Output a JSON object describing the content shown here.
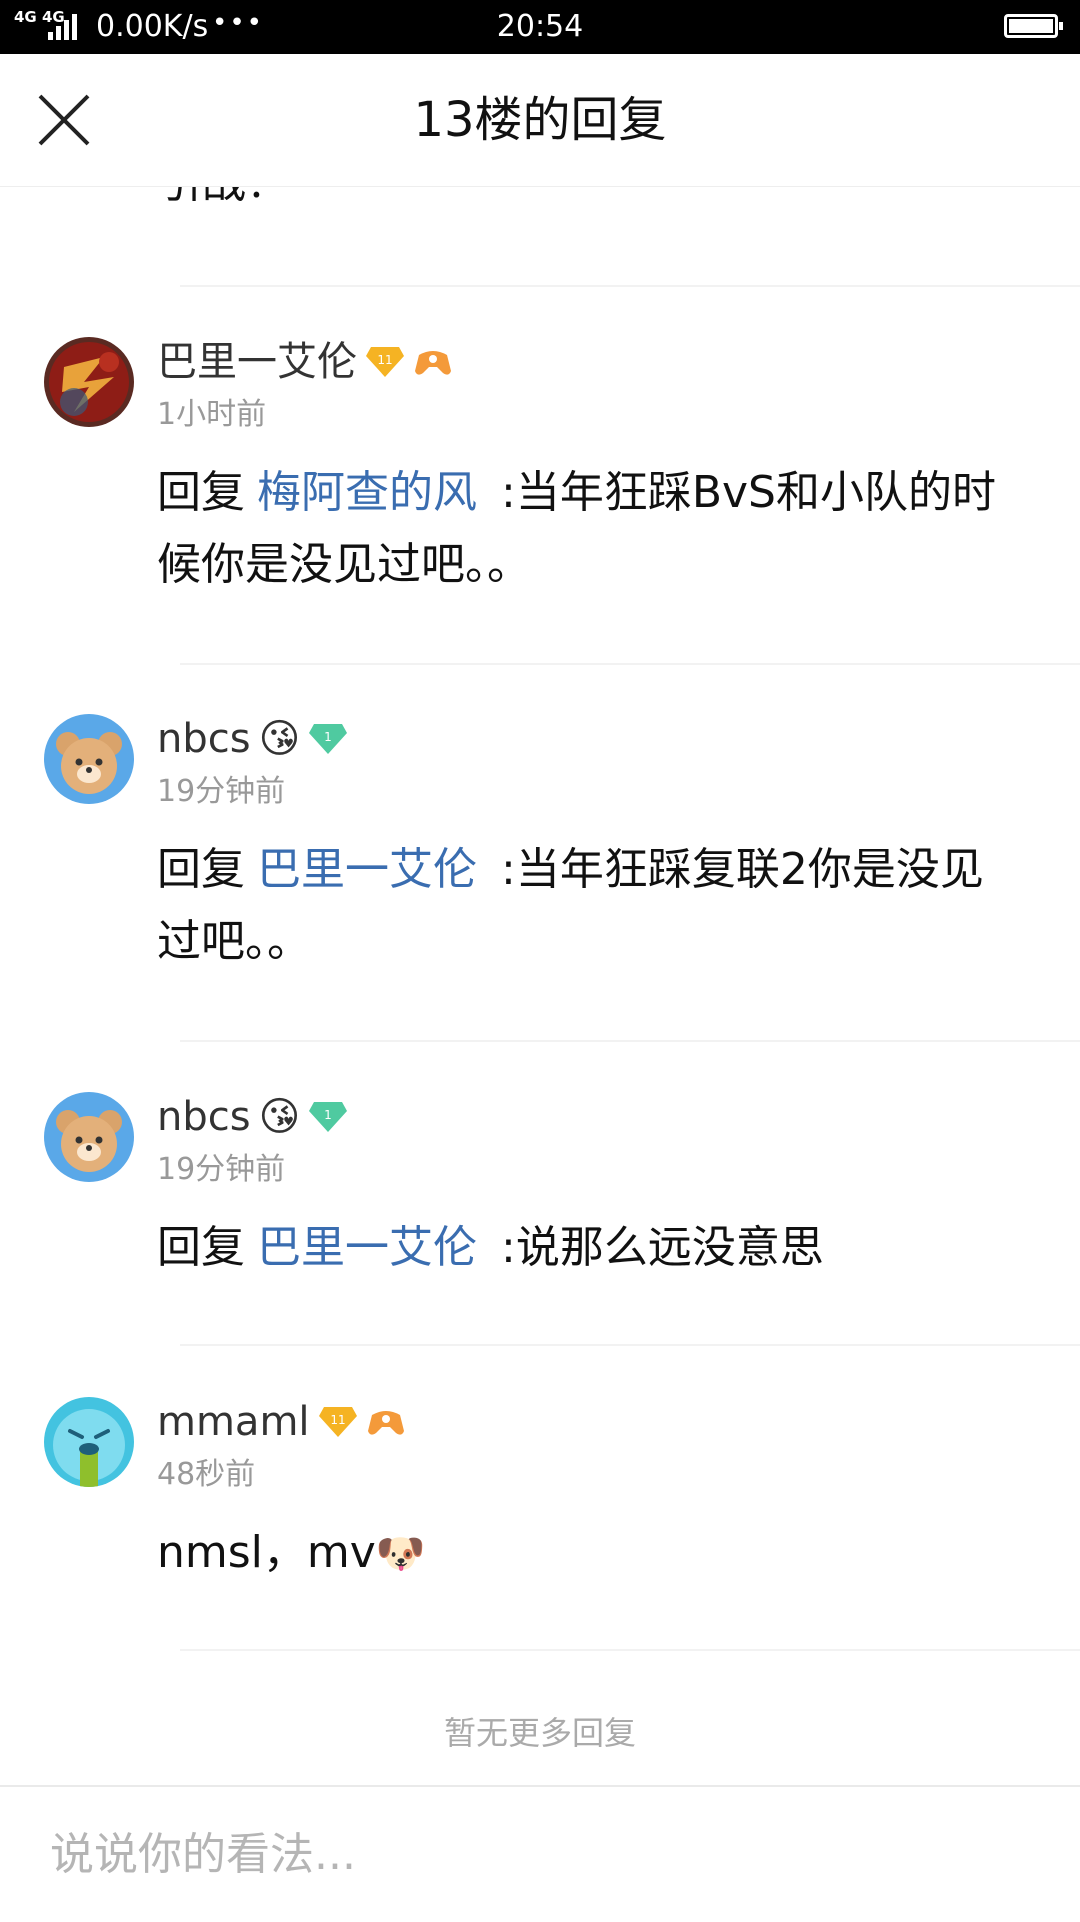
{
  "status_bar": {
    "network": "4G 4G",
    "speed": "0.00K/s",
    "dots": "•••",
    "time": "20:54"
  },
  "header": {
    "title": "13楼的回复"
  },
  "partial_text": "引战？",
  "comments": [
    {
      "username": "巴里一艾伦",
      "level": "11",
      "time": "1小时前",
      "reply_prefix": "回复",
      "reply_target": "梅阿查的风",
      "text": ":当年狂踩BvS和小队的时候你是没见过吧。。"
    },
    {
      "username": "nbcs",
      "emoji": "😘",
      "level": "1",
      "time": "19分钟前",
      "reply_prefix": "回复",
      "reply_target": "巴里一艾伦",
      "text": ":当年狂踩复联2你是没见过吧。。"
    },
    {
      "username": "nbcs",
      "emoji": "😘",
      "level": "1",
      "time": "19分钟前",
      "reply_prefix": "回复",
      "reply_target": "巴里一艾伦",
      "text": ":说那么远没意思"
    },
    {
      "username": "mmaml",
      "level": "11",
      "time": "48秒前",
      "text": "nmsl，mv",
      "text_emoji": "🐶"
    }
  ],
  "no_more": "暂无更多回复",
  "input": {
    "placeholder": "说说你的看法..."
  },
  "colors": {
    "link": "#3a6db0",
    "gold_badge": "#f5b323",
    "green_badge": "#4fcaa0"
  }
}
